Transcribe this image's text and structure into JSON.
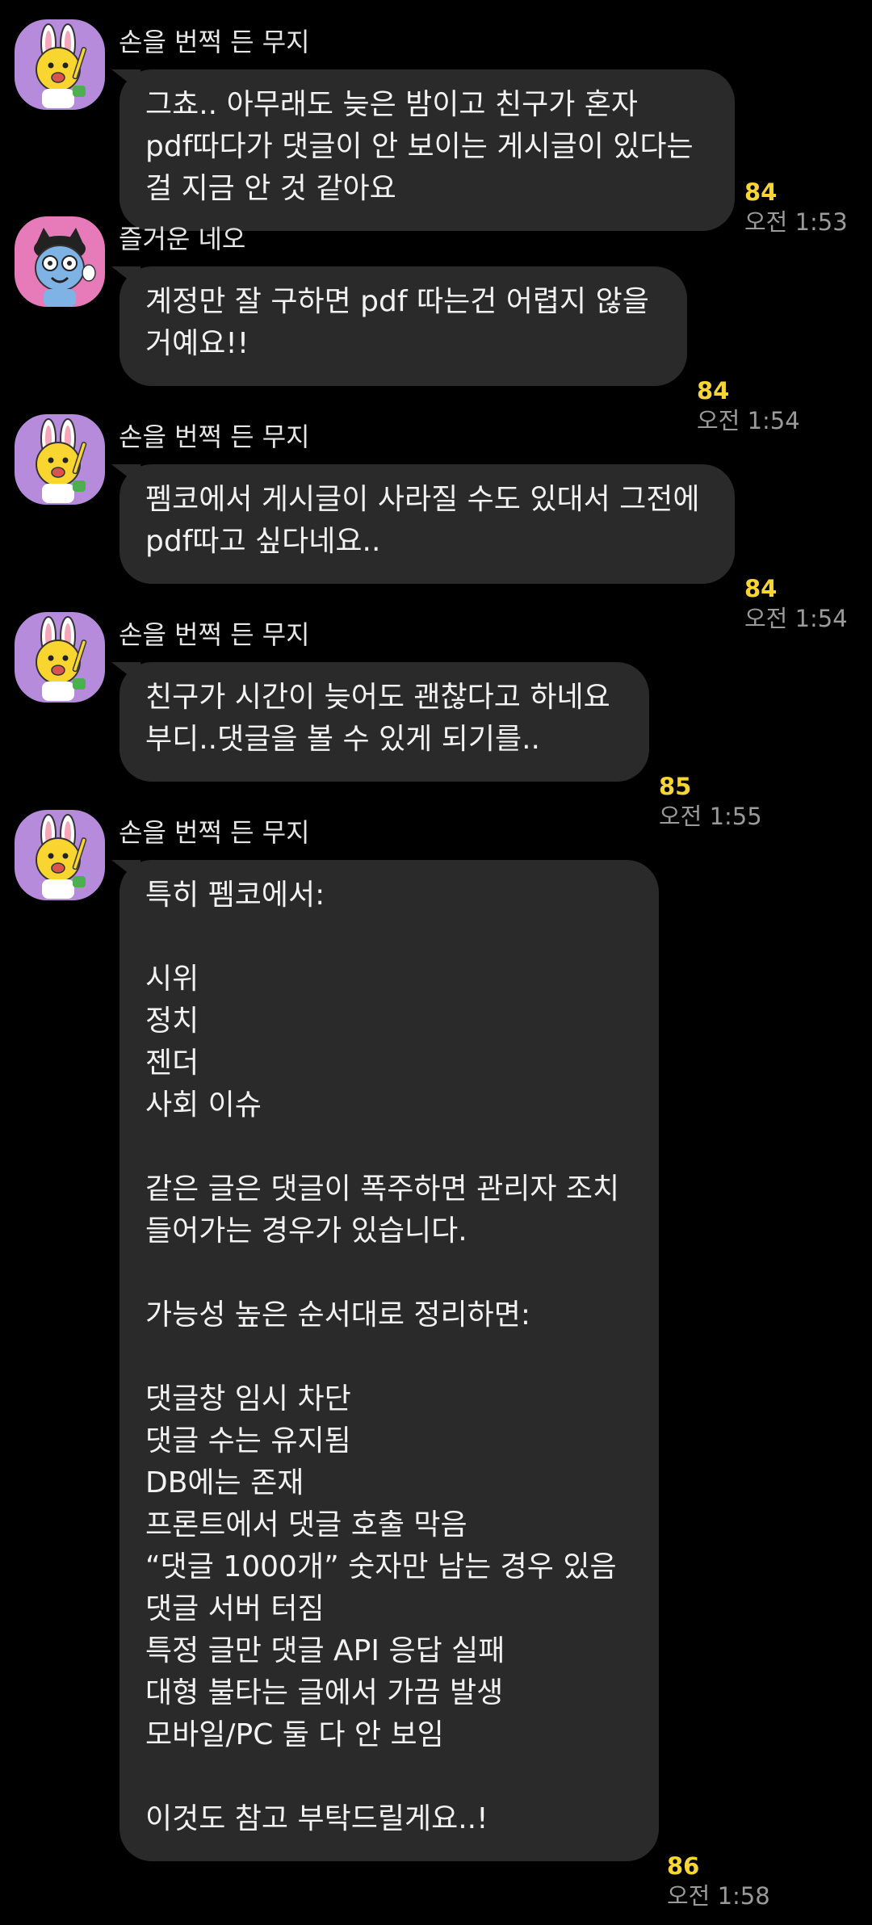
{
  "chat": {
    "messages": [
      {
        "sender": "손을 번쩍 든 무지",
        "avatar": "muzi-raising-hand-icon",
        "text": "그쵸.. 아무래도 늦은 밤이고 친구가 혼자\npdf따다가 댓글이 안 보이는 게시글이 있다는\n걸 지금 안 것 같아요",
        "unread": "84",
        "time": "오전 1:53"
      },
      {
        "sender": "즐거운 네오",
        "avatar": "happy-neo-icon",
        "text": "계정만 잘 구하면 pdf 따는건 어렵지 않을\n거예요!!",
        "unread": "84",
        "time": "오전 1:54"
      },
      {
        "sender": "손을 번쩍 든 무지",
        "avatar": "muzi-raising-hand-icon",
        "text": "펨코에서 게시글이 사라질 수도 있대서 그전에\npdf따고 싶다네요..",
        "unread": "84",
        "time": "오전 1:54"
      },
      {
        "sender": "손을 번쩍 든 무지",
        "avatar": "muzi-raising-hand-icon",
        "text": "친구가 시간이 늦어도 괜찮다고 하네요\n부디..댓글을 볼 수 있게 되기를..",
        "unread": "85",
        "time": "오전 1:55"
      },
      {
        "sender": "손을 번쩍 든 무지",
        "avatar": "muzi-raising-hand-icon",
        "text": "특히 펨코에서:\n\n시위\n정치\n젠더\n사회 이슈\n\n같은 글은 댓글이 폭주하면 관리자 조치\n들어가는 경우가 있습니다.\n\n가능성 높은 순서대로 정리하면:\n\n댓글창 임시 차단\n댓글 수는 유지됨\nDB에는 존재\n프론트에서 댓글 호출 막음\n“댓글 1000개” 숫자만 남는 경우 있음\n댓글 서버 터짐\n특정 글만 댓글 API 응답 실패\n대형 불타는 글에서 가끔 발생\n모바일/PC 둘 다 안 보임\n\n이것도 참고 부탁드릴게요..!",
        "unread": "86",
        "time": "오전 1:58"
      }
    ]
  },
  "colors": {
    "background": "#000000",
    "bubble": "#2a2a2a",
    "unread": "#f7d633",
    "time": "#9a9a9a",
    "muzi_avatar_bg": "#b78bdc",
    "neo_avatar_bg": "#e77ab8"
  }
}
